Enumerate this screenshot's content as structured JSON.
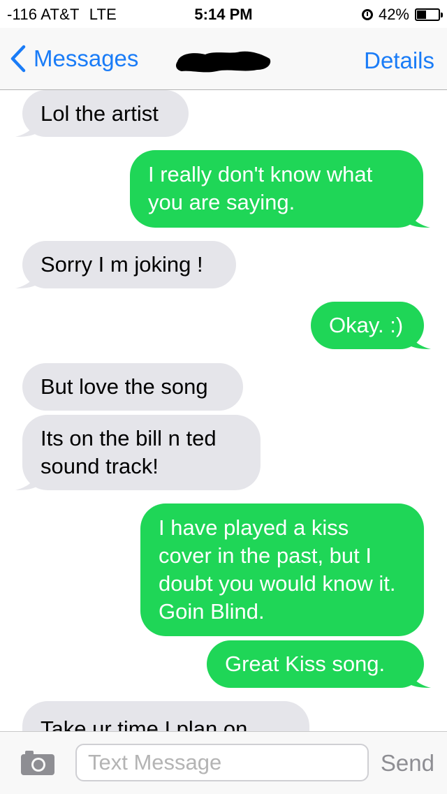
{
  "status_bar": {
    "carrier": "-116 AT&T",
    "network": "LTE",
    "time": "5:14 PM",
    "battery": "42%",
    "battery_level": 0.42
  },
  "nav": {
    "back_label": "Messages",
    "details_label": "Details"
  },
  "messages": [
    {
      "direction": "in",
      "text": "Lol the artist"
    },
    {
      "direction": "out",
      "text": "I really don't know what you are saying."
    },
    {
      "direction": "in",
      "text": "Sorry I m joking !"
    },
    {
      "direction": "out",
      "text": "Okay. :)"
    },
    {
      "direction": "in",
      "text": "But love the song"
    },
    {
      "direction": "in",
      "text": "Its on the bill n ted sound track!"
    },
    {
      "direction": "out",
      "text": "I have played a kiss cover in the past, but I doubt you would know it. Goin Blind."
    },
    {
      "direction": "out",
      "text": "Great Kiss song."
    },
    {
      "direction": "in",
      "text": "Take ur time I plan on"
    }
  ],
  "composer": {
    "placeholder": "Text Message",
    "send_label": "Send"
  },
  "icons": {
    "back": "chevron-left-icon",
    "camera": "camera-icon",
    "alarm": "alarm-icon",
    "battery": "battery-icon"
  },
  "colors": {
    "accent": "#1a7cf7",
    "incoming_bubble": "#e5e5ea",
    "outgoing_bubble": "#1fd657"
  }
}
